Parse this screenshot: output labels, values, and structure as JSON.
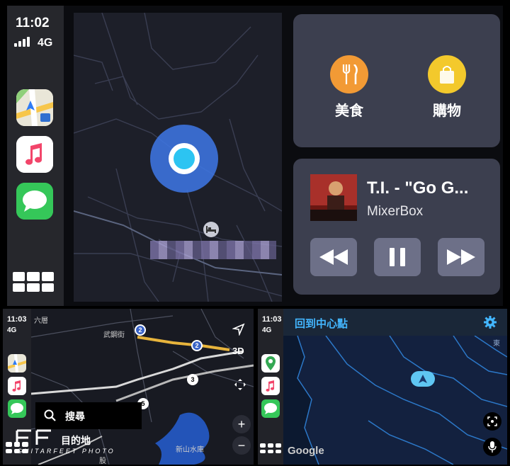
{
  "main": {
    "status": {
      "time": "11:02",
      "network": "4G"
    },
    "poi": [
      {
        "label": "美食",
        "color": "#f29a35",
        "icon": "fork-knife-icon"
      },
      {
        "label": "購物",
        "color": "#f3c92c",
        "icon": "shopping-bag-icon"
      }
    ],
    "now_playing": {
      "title": "T.I. - \"Go G...",
      "artist": "MixerBox",
      "album_art_text": "T.I. THE LIVE ROOM"
    }
  },
  "bottom_left": {
    "status": {
      "time": "11:03",
      "network": "4G"
    },
    "search_label": "搜尋",
    "map_labels": {
      "top_left": "六層",
      "street": "武鋼街",
      "reservoir": "新山水庫",
      "bottom": "股"
    },
    "route_badges": [
      "2",
      "2",
      "3",
      "5"
    ],
    "view_mode": "3D",
    "zoom_in": "+",
    "zoom_out": "−"
  },
  "bottom_right": {
    "status": {
      "time": "11:03",
      "network": "4G"
    },
    "header_title": "回到中心點",
    "map_attribution": "Google",
    "map_label": "東"
  },
  "watermark": {
    "text": "目的地",
    "sub": "GUITARFEET PHOTO"
  }
}
